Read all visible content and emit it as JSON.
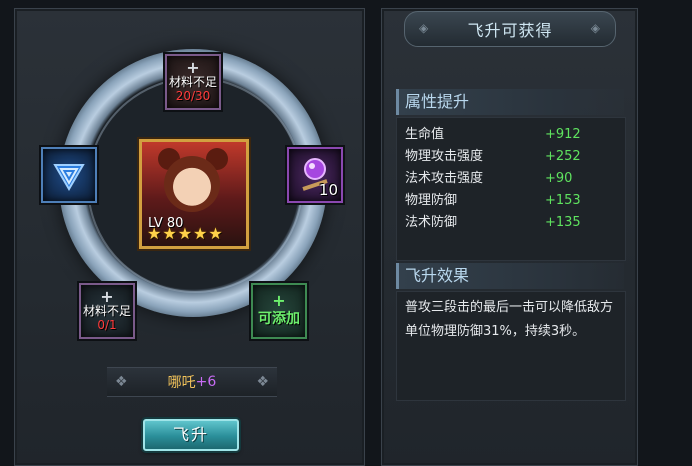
{
  "left": {
    "slots": {
      "top": {
        "plus": "+",
        "label": "材料不足",
        "count": "20/30"
      },
      "bottom_left": {
        "plus": "+",
        "label": "材料不足",
        "count": "0/1"
      },
      "bottom_right": {
        "plus": "+",
        "label": "可添加"
      },
      "left": {
        "icon": "blue-triangle-gem-icon"
      },
      "right": {
        "icon": "purple-orb-staff-icon",
        "count": "10"
      }
    },
    "hero": {
      "level": "LV 80",
      "stars": 5
    },
    "name_plate": {
      "name": "哪吒",
      "plus": "+6"
    },
    "ascend_button": "飞升"
  },
  "right": {
    "title": "飞升可获得",
    "attributes_header": "属性提升",
    "attributes": [
      {
        "name": "生命值",
        "value": "+912"
      },
      {
        "name": "物理攻击强度",
        "value": "+252"
      },
      {
        "name": "法术攻击强度",
        "value": "+90"
      },
      {
        "name": "物理防御",
        "value": "+153"
      },
      {
        "name": "法术防御",
        "value": "+135"
      }
    ],
    "effect_header": "飞升效果",
    "effect_text": "普攻三段击的最后一击可以降低敌方单位物理防御31%，持续3秒。"
  },
  "colors": {
    "value_green": "#5fe35f",
    "warning_red": "#ff3b3b",
    "hero_name_gold": "#f2c35a",
    "plus_purple": "#c86cf5",
    "button_teal": "#2a8e99"
  }
}
